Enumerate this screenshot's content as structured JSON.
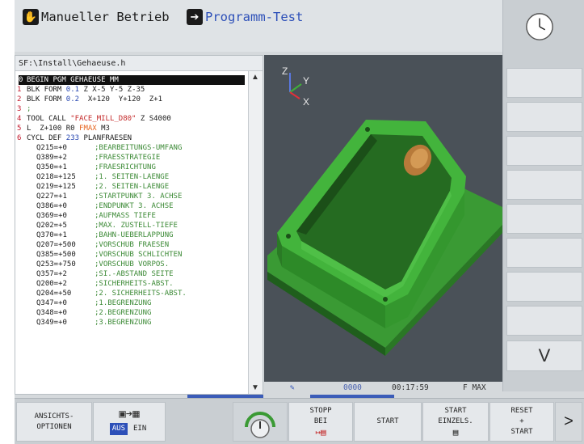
{
  "header": {
    "mode_manual": "Manueller Betrieb",
    "mode_test": "Programm-Test"
  },
  "program": {
    "path": "SF:\\Install\\Gehaeuse.h",
    "lines": [
      {
        "num": "0",
        "segs": [
          {
            "t": "BEGIN PGM GEHAEUSE MM",
            "c": ""
          }
        ],
        "selected": true
      },
      {
        "num": "1",
        "segs": [
          {
            "t": "BLK FORM ",
            "c": ""
          },
          {
            "t": "0.1",
            "c": "blue"
          },
          {
            "t": " Z X-5 Y-5 Z-35",
            "c": ""
          }
        ]
      },
      {
        "num": "2",
        "segs": [
          {
            "t": "BLK FORM ",
            "c": ""
          },
          {
            "t": "0.2",
            "c": "blue"
          },
          {
            "t": "  X+120  Y+120  Z+1",
            "c": ""
          }
        ]
      },
      {
        "num": "3",
        "segs": [
          {
            "t": ";",
            "c": "green"
          }
        ]
      },
      {
        "num": "4",
        "segs": [
          {
            "t": "TOOL CALL ",
            "c": ""
          },
          {
            "t": "\"FACE_MILL_D80\"",
            "c": "red"
          },
          {
            "t": " Z S4000",
            "c": ""
          }
        ]
      },
      {
        "num": "5",
        "segs": [
          {
            "t": "L  Z+100 R0 ",
            "c": ""
          },
          {
            "t": "FMAX",
            "c": "orange"
          },
          {
            "t": " M3",
            "c": ""
          }
        ]
      },
      {
        "num": "6",
        "segs": [
          {
            "t": "CYCL DEF ",
            "c": ""
          },
          {
            "t": "233",
            "c": "blue"
          },
          {
            "t": " PLANFRAESEN",
            "c": ""
          }
        ]
      },
      {
        "num": "",
        "param": "Q215=+0",
        "comment": ";BEARBEITUNGS-UMFANG"
      },
      {
        "num": "",
        "param": "Q389=+2",
        "comment": ";FRAESSTRATEGIE"
      },
      {
        "num": "",
        "param": "Q350=+1",
        "comment": ";FRAESRICHTUNG"
      },
      {
        "num": "",
        "param": "Q218=+125",
        "comment": ";1. SEITEN-LAENGE"
      },
      {
        "num": "",
        "param": "Q219=+125",
        "comment": ";2. SEITEN-LAENGE"
      },
      {
        "num": "",
        "param": "Q227=+1",
        "comment": ";STARTPUNKT 3. ACHSE"
      },
      {
        "num": "",
        "param": "Q386=+0",
        "comment": ";ENDPUNKT 3. ACHSE"
      },
      {
        "num": "",
        "param": "Q369=+0",
        "comment": ";AUFMASS TIEFE"
      },
      {
        "num": "",
        "param": "Q202=+5",
        "comment": ";MAX. ZUSTELL-TIEFE"
      },
      {
        "num": "",
        "param": "Q370=+1",
        "comment": ";BAHN-UEBERLAPPUNG"
      },
      {
        "num": "",
        "param": "Q207=+500",
        "comment": ";VORSCHUB FRAESEN"
      },
      {
        "num": "",
        "param": "Q385=+500",
        "comment": ";VORSCHUB SCHLICHTEN"
      },
      {
        "num": "",
        "param": "Q253=+750",
        "comment": ";VORSCHUB VORPOS."
      },
      {
        "num": "",
        "param": "Q357=+2",
        "comment": ";SI.-ABSTAND SEITE"
      },
      {
        "num": "",
        "param": "Q200=+2",
        "comment": ";SICHERHEITS-ABST."
      },
      {
        "num": "",
        "param": "Q204=+50",
        "comment": ";2. SICHERHEITS-ABST."
      },
      {
        "num": "",
        "param": "Q347=+0",
        "comment": ";1.BEGRENZUNG"
      },
      {
        "num": "",
        "param": "Q348=+0",
        "comment": ";2.BEGRENZUNG"
      },
      {
        "num": "",
        "param": "Q349=+0",
        "comment": ";3.BEGRENZUNG"
      }
    ]
  },
  "graphic": {
    "axis_z": "Z",
    "axis_y": "Y",
    "axis_x": "X",
    "dots": "0000",
    "runtime": "00:17:59",
    "feed": "F MAX"
  },
  "softkeys": {
    "ansichts_line1": "ANSICHTS-",
    "ansichts_line2": "OPTIONEN",
    "aus": "AUS",
    "ein": "EIN",
    "stopp_line1": "STOPP",
    "stopp_line2": "BEI",
    "start": "START",
    "einzel_line1": "START",
    "einzel_line2": "EINZELS.",
    "reset_line1": "RESET",
    "reset_line2": "+",
    "reset_line3": "START",
    "more": ">"
  },
  "rightbar": {
    "chevron": "V"
  },
  "colors": {
    "accent_blue": "#2c4fb8",
    "model_green": "#3fae3a",
    "program_red": "#c2182c"
  }
}
